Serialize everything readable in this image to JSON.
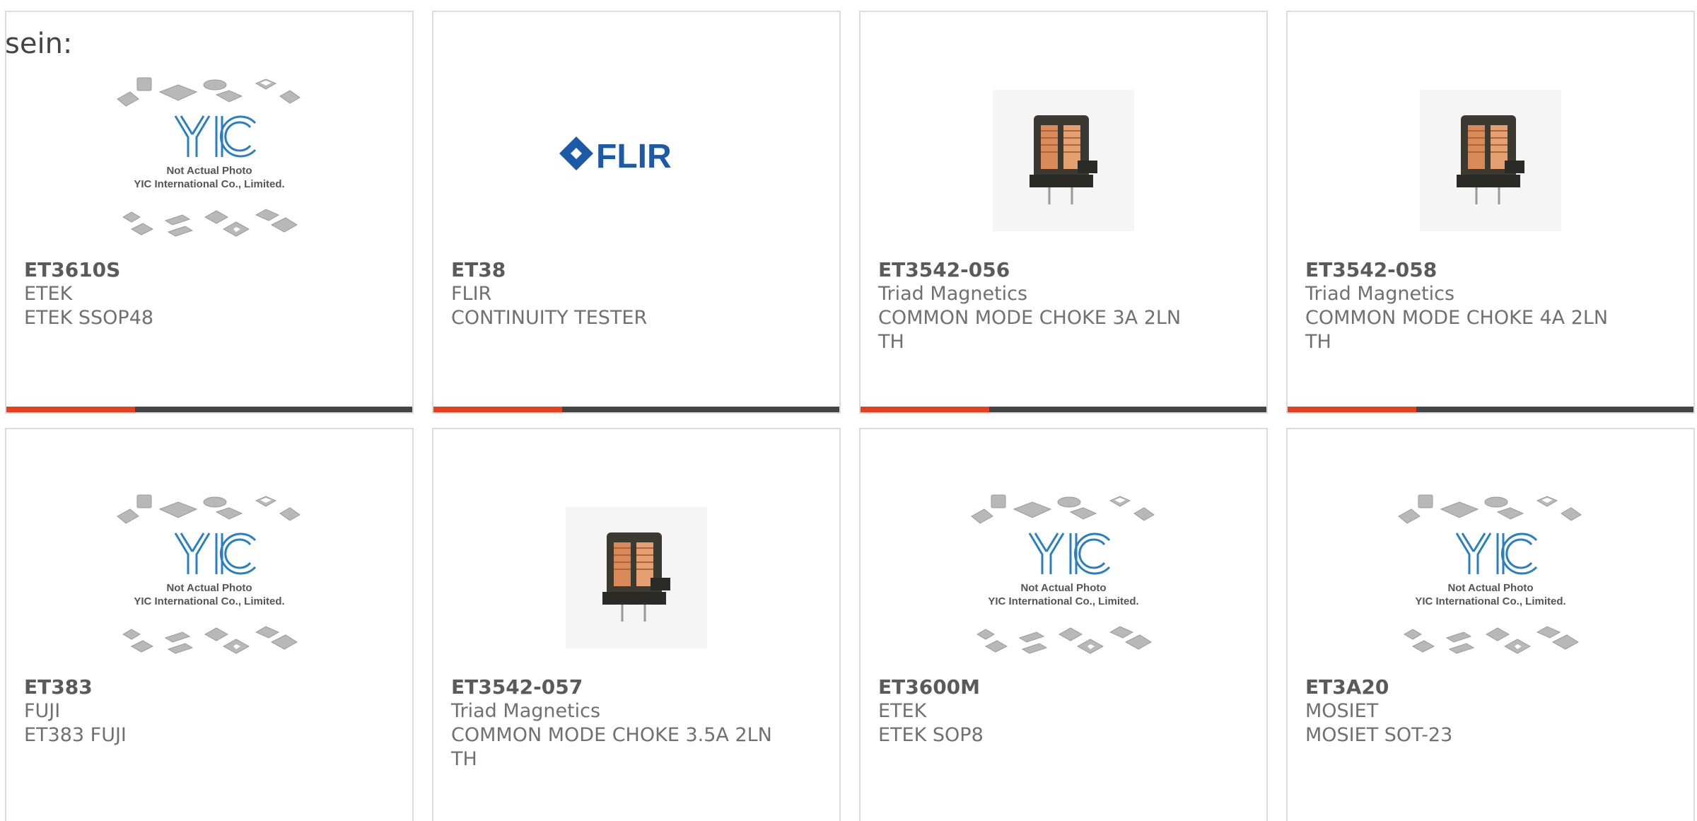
{
  "intro_text": "sein:",
  "placeholder": {
    "line1": "Not Actual Photo",
    "line2": "YIC International Co., Limited."
  },
  "colors": {
    "accent": "#e8401c",
    "bar": "#444444",
    "border": "#dcdcdc",
    "yic_blue": "#2a7fc0",
    "flir_blue": "#1c5aa8"
  },
  "products": [
    {
      "part": "ET3610S",
      "brand": "ETEK",
      "desc": "ETEK SSOP48",
      "image": "yic-placeholder-icon"
    },
    {
      "part": "ET38",
      "brand": "FLIR",
      "desc": "CONTINUITY TESTER",
      "image": "flir-logo"
    },
    {
      "part": "ET3542-056",
      "brand": "Triad Magnetics",
      "desc": "COMMON MODE CHOKE 3A 2LN\nTH",
      "image": "choke-photo"
    },
    {
      "part": "ET3542-058",
      "brand": "Triad Magnetics",
      "desc": "COMMON MODE CHOKE 4A 2LN\nTH",
      "image": "choke-photo"
    },
    {
      "part": "ET383",
      "brand": "FUJI",
      "desc": "ET383 FUJI",
      "image": "yic-placeholder-icon"
    },
    {
      "part": "ET3542-057",
      "brand": "Triad Magnetics",
      "desc": "COMMON MODE CHOKE 3.5A 2LN\nTH",
      "image": "choke-photo"
    },
    {
      "part": "ET3600M",
      "brand": "ETEK",
      "desc": "ETEK SOP8",
      "image": "yic-placeholder-icon"
    },
    {
      "part": "ET3A20",
      "brand": "MOSIET",
      "desc": "MOSIET SOT-23",
      "image": "yic-placeholder-icon"
    }
  ]
}
